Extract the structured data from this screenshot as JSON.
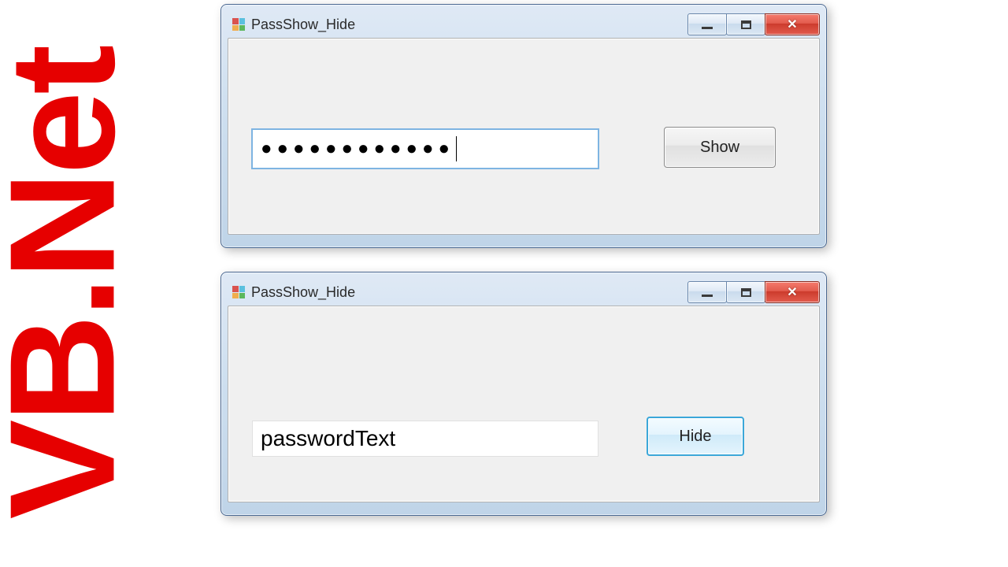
{
  "side_label": "VB.Net",
  "window1": {
    "title": "PassShow_Hide",
    "password_mask": "●●●●●●●●●●●●",
    "button_label": "Show"
  },
  "window2": {
    "title": "PassShow_Hide",
    "password_value": "passwordText",
    "button_label": "Hide"
  }
}
